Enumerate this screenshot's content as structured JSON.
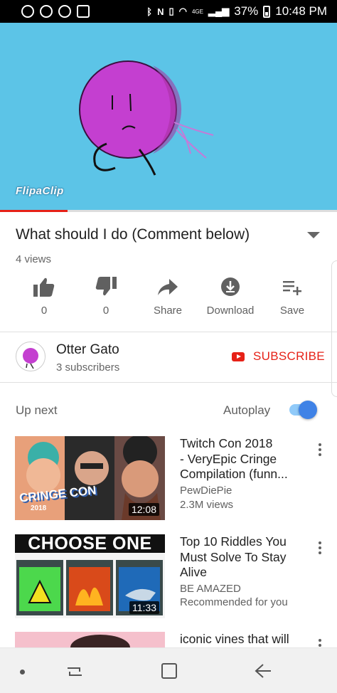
{
  "status_bar": {
    "left_icons": [
      "spotify-icon",
      "alarm-icon",
      "do-not-disturb-icon",
      "screenshot-icon"
    ],
    "right_icons": [
      "bluetooth-icon",
      "nfc-icon",
      "vibrate-icon",
      "wifi-icon",
      "signal-icon"
    ],
    "network": "4GE",
    "battery": "37%",
    "time": "10:48 PM"
  },
  "video": {
    "watermark": "FlipaClip",
    "progress_fraction": 0.2,
    "title": "What should I do (Comment below)",
    "views": "4 views"
  },
  "actions": {
    "like_count": "0",
    "dislike_count": "0",
    "share_label": "Share",
    "download_label": "Download",
    "save_label": "Save"
  },
  "channel": {
    "name": "Otter Gato",
    "subscribers": "3 subscribers",
    "subscribe_label": "SUBSCRIBE"
  },
  "up_next": {
    "label": "Up next",
    "autoplay_label": "Autoplay",
    "autoplay_on": true,
    "items": [
      {
        "title_lines": [
          "Twitch Con 2018",
          "- VeryEpic Cringe",
          "Compilation (funn..."
        ],
        "channel": "PewDiePie",
        "meta": "2.3M views",
        "duration": "12:08",
        "thumb_text": "CRINGE CON",
        "thumb_year": "2018"
      },
      {
        "title_lines": [
          "Top 10 Riddles You",
          "Must Solve To Stay",
          "Alive"
        ],
        "channel": "BE AMAZED",
        "meta": "Recommended for you",
        "duration": "11:33",
        "thumb_text": "CHOOSE ONE"
      },
      {
        "title_lines": [
          "iconic vines that will"
        ]
      }
    ]
  },
  "colors": {
    "accent_red": "#e62117",
    "toggle_blue": "#3f82e6",
    "player_bg": "#5cc4e7"
  }
}
